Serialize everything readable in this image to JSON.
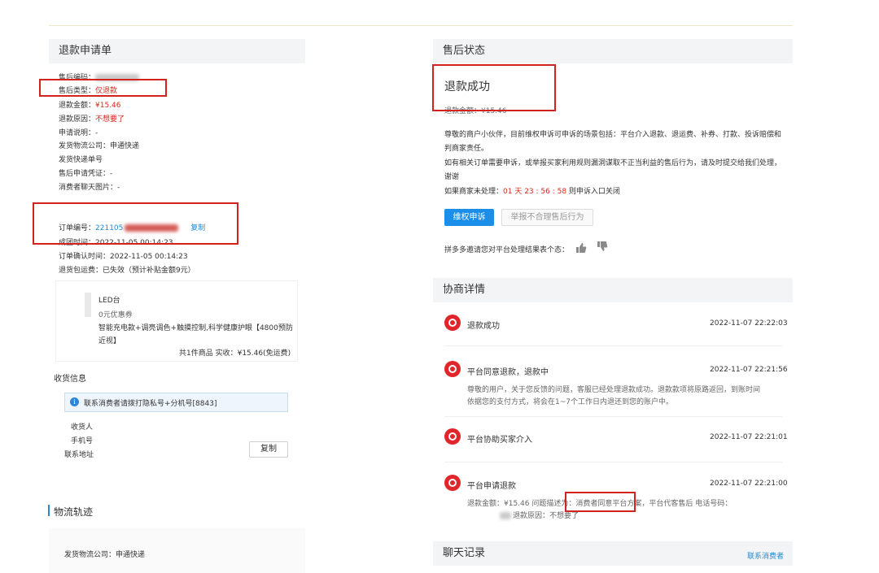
{
  "left": {
    "title": "退款申请单",
    "fields": {
      "aftersale_no_label": "售后编码：",
      "aftersale_type_label": "售后类型：",
      "aftersale_type_value": "仅退款",
      "refund_amount_label": "退款金额：",
      "refund_amount_value": "¥15.46",
      "refund_reason_label": "退款原因：",
      "refund_reason_value": "不想要了",
      "apply_desc": "申请说明：-",
      "ship_company": "发货物流公司：申通快递",
      "ship_no": "发货快递单号",
      "voucher": "售后申请凭证：-",
      "chat_img": "消费者聊天图片：-",
      "order_no_label": "订单编号：",
      "order_no_value": "221105",
      "copy": "复制",
      "group_time": "成团时间：2022-11-05 00:14:23",
      "confirm_time": "订单确认时间：2022-11-05 00:14:23",
      "return_fee": "退货包运费：已失效（预计补贴金额9元）"
    },
    "product": {
      "name_short": "LED台",
      "coupon": "0元优惠券",
      "desc_line1": "智能充电款+调亮调色+触摸控制,科学健康护眼【4800预防",
      "desc_line2": "近视】",
      "summary": "共1件商品   实收：¥15.46(免运费)"
    },
    "receiver": {
      "title": "收货信息",
      "notice": "联系消费者请拨打隐私号+分机号[8843]",
      "receiver_label": "收货人",
      "phone_label": "手机号",
      "address_label": "联系地址",
      "copy_button": "复制"
    },
    "logistics": {
      "title": "物流轨迹",
      "company": "发货物流公司：申通快递"
    }
  },
  "right": {
    "status": {
      "title": "售后状态",
      "result": "退款成功",
      "amount": "退款金额：¥15.46",
      "text1": "尊敬的商户小伙伴，目前维权申诉可申诉的场景包括：平台介入退款、退运费、补券、打款、投诉赔偿和",
      "text1b": "判商家责任。",
      "text2": "如有相关订单需要申诉，或举报买家利用规则漏洞谋取不正当利益的售后行为，请及时提交给我们处理，",
      "text2b": "谢谢",
      "countdown_prefix": "如果商家未处理：",
      "countdown": "01 天 23 : 56 : 58",
      "countdown_suffix": " 则申诉入口关闭",
      "appeal_button": "维权申诉",
      "report_button": "举报不合理售后行为",
      "feedback": "拼多多邀请您对平台处理结果表个态："
    },
    "negotiation": {
      "title": "协商详情",
      "items": [
        {
          "title": "退款成功",
          "time": "2022-11-07 22:22:03"
        },
        {
          "title": "平台同意退款，退款中",
          "time": "2022-11-07 22:21:56",
          "line1": "尊敬的用户，关于您反馈的问题，客服已经处理退款成功。退款款项将原路返回，到账时间",
          "line2": "依据您的支付方式，将会在1~7个工作日内退还到您的账户中。"
        },
        {
          "title": "平台协助买家介入",
          "time": "2022-11-07 22:21:01"
        },
        {
          "title": "平台申请退款",
          "time": "2022-11-07 22:21:00",
          "line1a": "退款金额：¥15.46 问题描述为：",
          "line1b": "消费者同意平台方案",
          "line1c": "，平台代客售后 电话号码：",
          "line2": "退款原因：不想要了"
        }
      ]
    },
    "chat": {
      "title": "聊天记录",
      "contact": "联系消费者"
    }
  },
  "colors": {
    "accent_red": "#d9261c",
    "link_blue": "#1f8ad6",
    "primary_button": "#1a8ee8",
    "badge_red": "#e0262b",
    "annotation_box": "#d3231f"
  }
}
